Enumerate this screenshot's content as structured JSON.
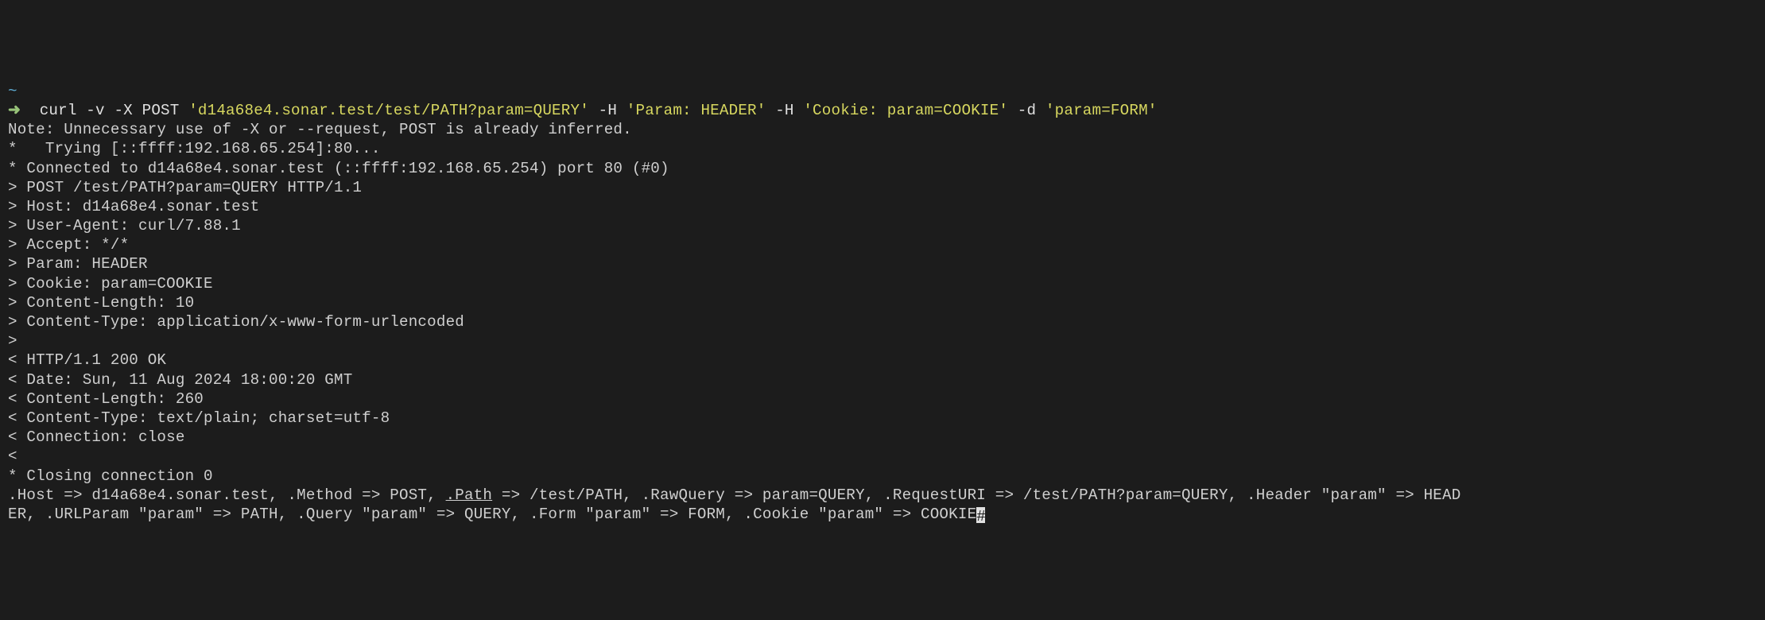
{
  "prompt": {
    "tilde": "~",
    "arrow": "➜",
    "cmd_curl": "curl",
    "flag_v": " -v",
    "flag_x": " -X",
    "method": " POST ",
    "url": "'d14a68e4.sonar.test/test/PATH?param=QUERY'",
    "flag_h1": " -H ",
    "header1": "'Param: HEADER'",
    "flag_h2": " -H ",
    "header2": "'Cookie: param=COOKIE'",
    "flag_d": " -d ",
    "data": "'param=FORM'"
  },
  "lines": {
    "note": "Note: Unnecessary use of -X or --request, POST is already inferred.",
    "trying": "*   Trying [::ffff:192.168.65.254]:80...",
    "connected": "* Connected to d14a68e4.sonar.test (::ffff:192.168.65.254) port 80 (#0)",
    "req1": "> POST /test/PATH?param=QUERY HTTP/1.1",
    "req2": "> Host: d14a68e4.sonar.test",
    "req3": "> User-Agent: curl/7.88.1",
    "req4": "> Accept: */*",
    "req5": "> Param: HEADER",
    "req6": "> Cookie: param=COOKIE",
    "req7": "> Content-Length: 10",
    "req8": "> Content-Type: application/x-www-form-urlencoded",
    "req9": ">",
    "res1": "< HTTP/1.1 200 OK",
    "res2": "< Date: Sun, 11 Aug 2024 18:00:20 GMT",
    "res3": "< Content-Length: 260",
    "res4": "< Content-Type: text/plain; charset=utf-8",
    "res5": "< Connection: close",
    "res6": "<",
    "closing": "* Closing connection 0",
    "body_a": ".Host => d14a68e4.sonar.test, .Method => POST, ",
    "body_path": ".Path",
    "body_b": " => /test/PATH, .RawQuery => param=QUERY, .RequestURI => /test/PATH?param=QUERY, .Header \"param\" => HEAD",
    "body_c": "ER, .URLParam \"param\" => PATH, .Query \"param\" => QUERY, .Form \"param\" => FORM, .Cookie \"param\" => COOKIE"
  }
}
